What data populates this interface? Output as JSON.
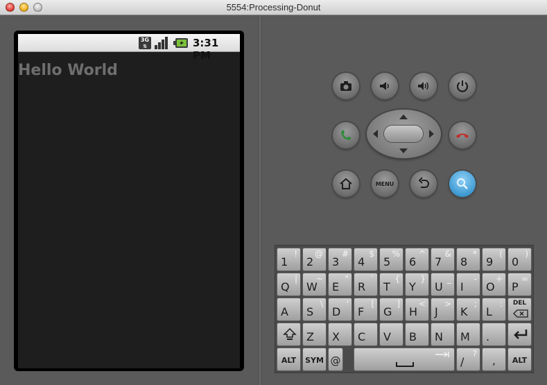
{
  "window": {
    "title": "5554:Processing-Donut"
  },
  "statusbar": {
    "network": "3G",
    "time": "3:31 PM"
  },
  "app": {
    "text": "Hello World"
  },
  "controls": {
    "menu_label": "MENU"
  },
  "keyboard": {
    "rows": [
      [
        {
          "main": "1",
          "alt": "!"
        },
        {
          "main": "2",
          "alt": "@"
        },
        {
          "main": "3",
          "alt": "#"
        },
        {
          "main": "4",
          "alt": "$"
        },
        {
          "main": "5",
          "alt": "%"
        },
        {
          "main": "6",
          "alt": "^"
        },
        {
          "main": "7",
          "alt": "&"
        },
        {
          "main": "8",
          "alt": "*"
        },
        {
          "main": "9",
          "alt": "("
        },
        {
          "main": "0",
          "alt": ")"
        }
      ],
      [
        {
          "main": "Q",
          "alt": "|"
        },
        {
          "main": "W",
          "alt": "~"
        },
        {
          "main": "E",
          "alt": "\""
        },
        {
          "main": "R",
          "alt": "`"
        },
        {
          "main": "T",
          "alt": "{"
        },
        {
          "main": "Y",
          "alt": "}"
        },
        {
          "main": "U",
          "alt": "_"
        },
        {
          "main": "I",
          "alt": "-"
        },
        {
          "main": "O",
          "alt": "+"
        },
        {
          "main": "P",
          "alt": "="
        }
      ],
      [
        {
          "main": "A",
          "alt": ""
        },
        {
          "main": "S",
          "alt": "\\"
        },
        {
          "main": "D",
          "alt": "'"
        },
        {
          "main": "F",
          "alt": "["
        },
        {
          "main": "G",
          "alt": "]"
        },
        {
          "main": "H",
          "alt": "<"
        },
        {
          "main": "J",
          "alt": ">"
        },
        {
          "main": "K",
          "alt": ";"
        },
        {
          "main": "L",
          "alt": ":"
        },
        {
          "main": "DEL",
          "alt": ""
        }
      ],
      [
        {
          "main": "",
          "alt": ""
        },
        {
          "main": "Z",
          "alt": ""
        },
        {
          "main": "X",
          "alt": ""
        },
        {
          "main": "C",
          "alt": ""
        },
        {
          "main": "V",
          "alt": ""
        },
        {
          "main": "B",
          "alt": ""
        },
        {
          "main": "N",
          "alt": ""
        },
        {
          "main": "M",
          "alt": ""
        },
        {
          "main": ".",
          "alt": ""
        },
        {
          "main": "",
          "alt": ""
        }
      ]
    ],
    "bottom": {
      "alt_left": "ALT",
      "sym": "SYM",
      "at": "@",
      "slash": "/",
      "slash_alt": "?",
      "comma": ",",
      "alt_right": "ALT"
    }
  }
}
